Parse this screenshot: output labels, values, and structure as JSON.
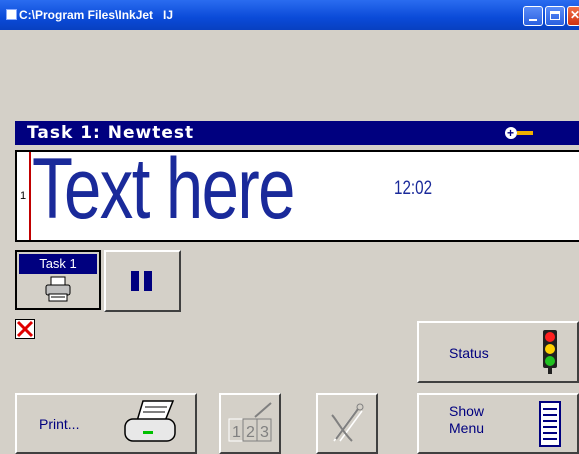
{
  "window": {
    "title": "C:\\Program Files\\InkJet   IJ"
  },
  "task_header": {
    "title": "Task 1: Newtest"
  },
  "editor": {
    "line_number": "1",
    "text": "Text here",
    "time": "12:02"
  },
  "task_button": {
    "label": "Task 1"
  },
  "buttons": {
    "print": "Print...",
    "status": "Status",
    "show_menu_line1": "Show",
    "show_menu_line2": "Menu"
  },
  "icons": {
    "printer": "printer-icon",
    "pause": "pause-icon",
    "error": "error-x-icon",
    "traffic_light": "traffic-light-icon",
    "counter": "counter-edit-icon",
    "tools": "tools-icon",
    "menu_list": "menu-list-icon"
  },
  "colors": {
    "title_bar": "#0a4ad8",
    "task_bar": "#00007f",
    "text": "#1a2a9a",
    "background": "#d4d0c8"
  }
}
